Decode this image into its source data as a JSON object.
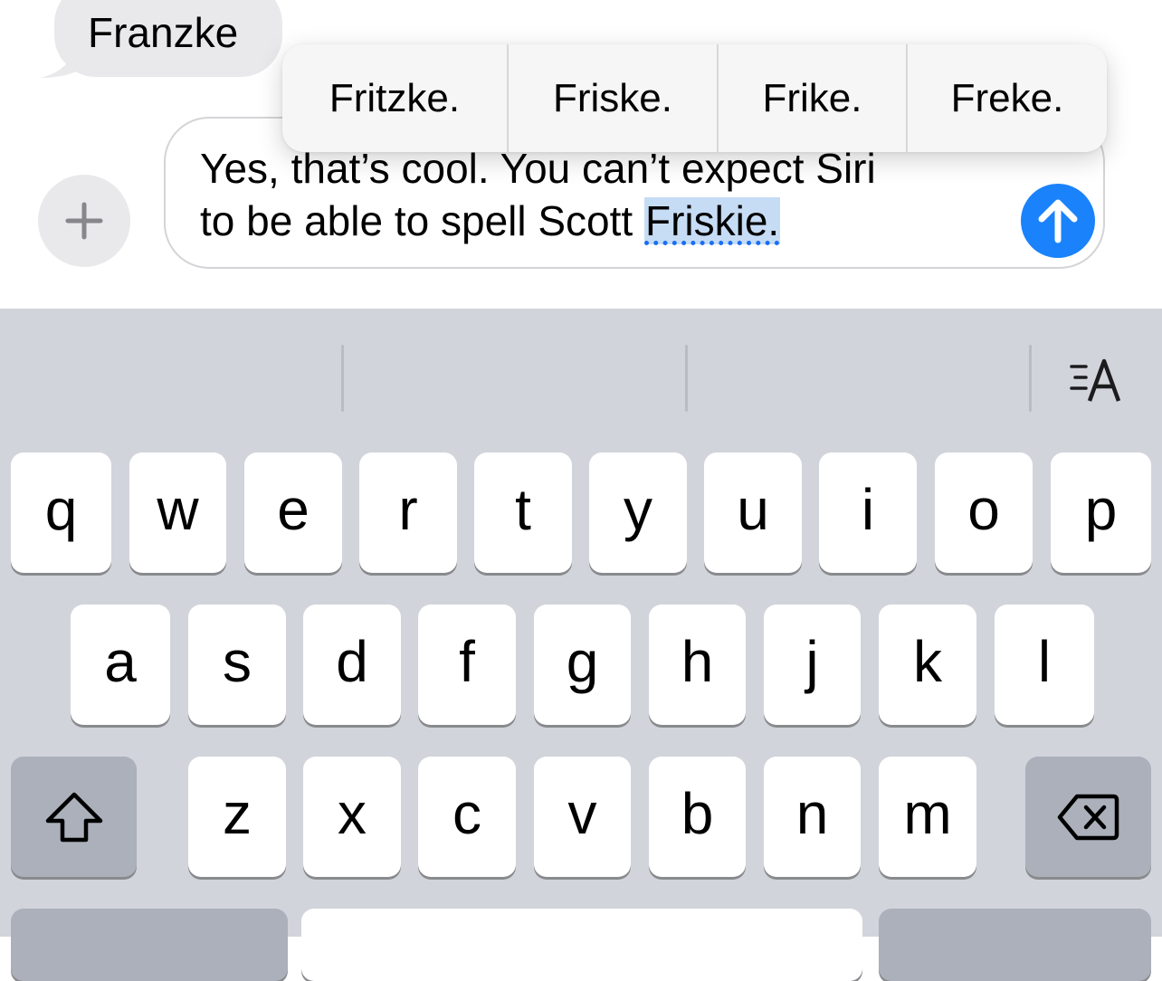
{
  "conversation": {
    "incoming_message": "Franzke"
  },
  "composer": {
    "text_before": "Yes, that’s cool. You can’t expect Siri",
    "text_line2_before": "to be able to spell Scott ",
    "selected_word": "Friskie.",
    "plus_icon": "plus-icon",
    "send_icon": "arrow-up-icon",
    "send_color": "#1a82fb"
  },
  "suggestions": [
    "Fritzke.",
    "Friske.",
    "Frike.",
    "Freke."
  ],
  "keyboard": {
    "row1": [
      "q",
      "w",
      "e",
      "r",
      "t",
      "y",
      "u",
      "i",
      "o",
      "p"
    ],
    "row2": [
      "a",
      "s",
      "d",
      "f",
      "g",
      "h",
      "j",
      "k",
      "l"
    ],
    "row3": [
      "z",
      "x",
      "c",
      "v",
      "b",
      "n",
      "m"
    ],
    "shift_icon": "shift-icon",
    "delete_icon": "backspace-icon",
    "format_icon": "text-format-icon"
  }
}
